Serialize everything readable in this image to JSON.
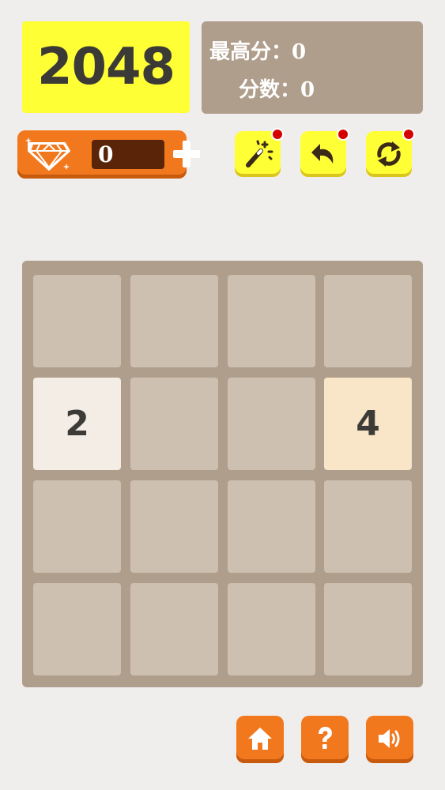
{
  "logo": {
    "text": "2048"
  },
  "scores": {
    "best_label": "最高分",
    "best_value": "0",
    "current_label": "分数",
    "current_value": "0"
  },
  "gems": {
    "count": "0"
  },
  "tools": [
    "magic-wand-icon",
    "undo-icon",
    "refresh-icon"
  ],
  "board": {
    "rows": 4,
    "cols": 4,
    "tiles": [
      [
        "",
        "",
        "",
        ""
      ],
      [
        "2",
        "",
        "",
        "4"
      ],
      [
        "",
        "",
        "",
        ""
      ],
      [
        "",
        "",
        "",
        ""
      ]
    ]
  },
  "bottom_buttons": [
    "home-icon",
    "help-icon",
    "sound-icon"
  ],
  "colors": {
    "background": "#efeeed",
    "logo_bg": "#ffff35",
    "board_bg": "#b09e8c",
    "empty_tile": "#cdc0b0",
    "tile_2": "#f3ede5",
    "tile_4": "#f9e5c8",
    "orange": "#f2781e"
  }
}
